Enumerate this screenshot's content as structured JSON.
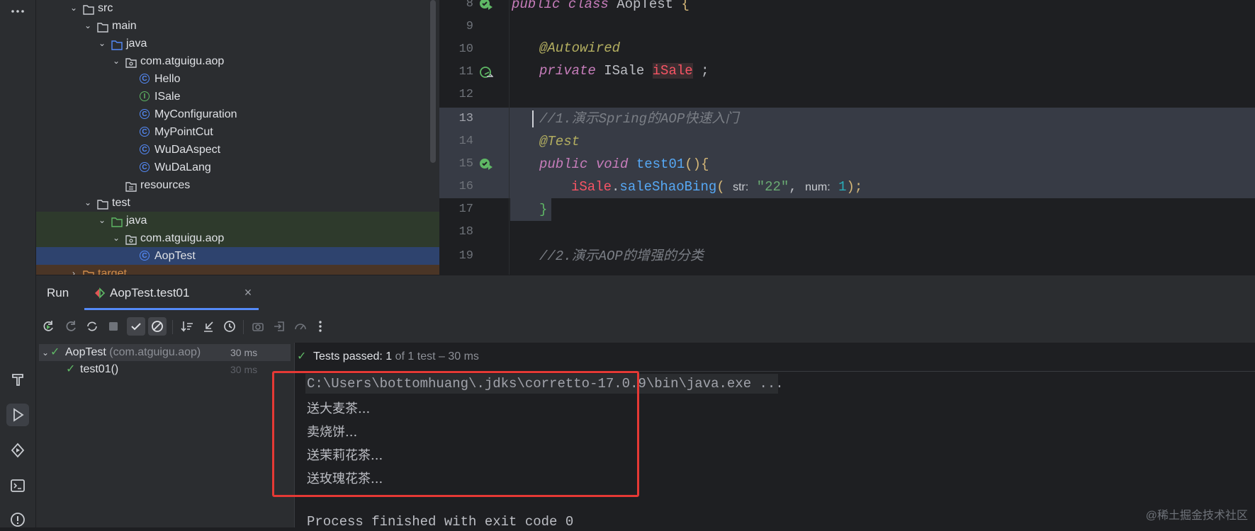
{
  "project_tree": {
    "items": [
      {
        "label": "src",
        "type": "folder",
        "indent": 0,
        "expanded": true
      },
      {
        "label": "main",
        "type": "folder",
        "indent": 1,
        "expanded": true
      },
      {
        "label": "java",
        "type": "source-folder",
        "indent": 2,
        "expanded": true
      },
      {
        "label": "com.atguigu.aop",
        "type": "package",
        "indent": 3,
        "expanded": true
      },
      {
        "label": "Hello",
        "type": "class",
        "indent": 4
      },
      {
        "label": "ISale",
        "type": "interface",
        "indent": 4
      },
      {
        "label": "MyConfiguration",
        "type": "class",
        "indent": 4
      },
      {
        "label": "MyPointCut",
        "type": "class",
        "indent": 4
      },
      {
        "label": "WuDaAspect",
        "type": "class",
        "indent": 4
      },
      {
        "label": "WuDaLang",
        "type": "class",
        "indent": 4
      },
      {
        "label": "resources",
        "type": "resources-folder",
        "indent": 3
      },
      {
        "label": "test",
        "type": "folder",
        "indent": 1,
        "expanded": true
      },
      {
        "label": "java",
        "type": "test-folder",
        "indent": 2,
        "expanded": true
      },
      {
        "label": "com.atguigu.aop",
        "type": "package",
        "indent": 3,
        "expanded": true
      },
      {
        "label": "AopTest",
        "type": "class",
        "indent": 4,
        "selected": true
      },
      {
        "label": "target",
        "type": "excluded-folder",
        "indent": 0,
        "expanded": false
      }
    ]
  },
  "editor": {
    "line_numbers": [
      "8",
      "9",
      "10",
      "11",
      "12",
      "13",
      "14",
      "15",
      "16",
      "17",
      "18",
      "19"
    ],
    "current_line": "13",
    "line8": {
      "kw1": "public",
      "kw2": "class",
      "name": "AopTest",
      "brace": "{"
    },
    "line10": {
      "annotation": "@Autowired"
    },
    "line11": {
      "kw": "private",
      "type": "ISale",
      "field": "iSale",
      "semi": ";"
    },
    "line13": {
      "comment": "//1.演示Spring的AOP快速入门"
    },
    "line14": {
      "annotation": "@Test"
    },
    "line15": {
      "kw1": "public",
      "kw2": "void",
      "method": "test01",
      "paren": "(){"
    },
    "line16": {
      "field": "iSale",
      "dot": ".",
      "method": "saleShaoBing",
      "open": "(",
      "hint_str": "str:",
      "str_value": "\"22\"",
      "comma": ",",
      "hint_num": "num:",
      "num_value": "1",
      "close": ");"
    },
    "line17": {
      "brace": "}"
    },
    "line19": {
      "comment": "//2.演示AOP的增强的分类"
    }
  },
  "run_panel": {
    "title": "Run",
    "tab_label": "AopTest.test01",
    "status_prefix": "Tests passed:",
    "status_count": "1",
    "status_suffix": "of 1 test – 30 ms",
    "tests": [
      {
        "name": "AopTest",
        "package": "(com.atguigu.aop)",
        "time": "30 ms"
      },
      {
        "name": "test01()",
        "time": "30 ms"
      }
    ],
    "console": [
      "C:\\Users\\bottomhuang\\.jdks\\corretto-17.0.9\\bin\\java.exe ...",
      "送大麦茶...",
      "卖烧饼...",
      "送茉莉花茶...",
      "送玫瑰花茶...",
      "",
      "Process finished with exit code 0"
    ]
  },
  "watermark": "@稀土掘金技术社区",
  "colors": {
    "accent": "#548af7",
    "success": "#5fb865",
    "highlight_box": "#e53935"
  }
}
